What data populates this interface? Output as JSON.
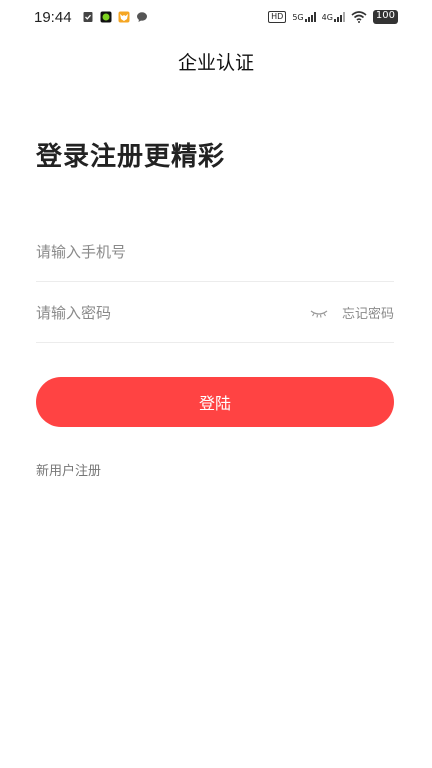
{
  "status_bar": {
    "time": "19:44",
    "hd_label": "HD",
    "net1_label": "5G",
    "net2_label": "4G",
    "battery": "100",
    "notification_icons": [
      "shield-check-icon",
      "green-app-icon",
      "fox-app-icon",
      "chat-bubble-icon"
    ]
  },
  "header": {
    "title": "企业认证"
  },
  "main": {
    "headline": "登录注册更精彩",
    "phone_placeholder": "请输入手机号",
    "password_placeholder": "请输入密码",
    "forgot_label": "忘记密码",
    "login_label": "登陆",
    "register_label": "新用户注册"
  },
  "colors": {
    "accent": "#ff4343",
    "placeholder": "#8a8a8a",
    "divider": "#ececec"
  }
}
